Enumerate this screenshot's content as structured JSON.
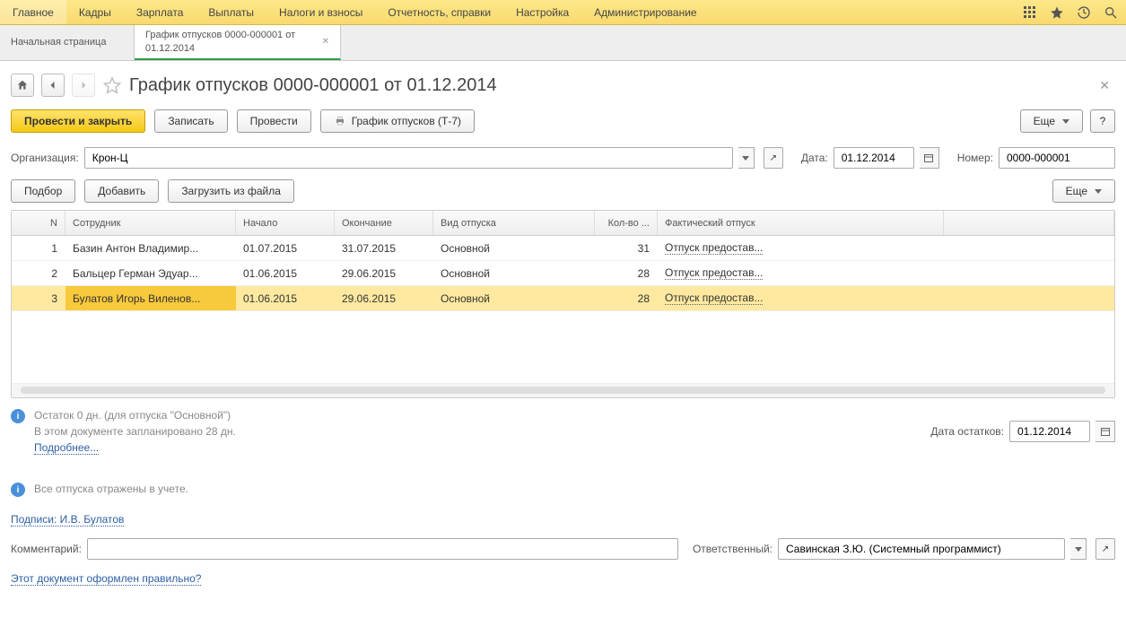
{
  "topmenu": [
    "Главное",
    "Кадры",
    "Зарплата",
    "Выплаты",
    "Налоги и взносы",
    "Отчетность, справки",
    "Настройка",
    "Администрирование"
  ],
  "tabs": {
    "home": "Начальная страница",
    "active": "График отпусков 0000-000001 от 01.12.2014"
  },
  "title": "График отпусков 0000-000001 от 01.12.2014",
  "toolbar": {
    "post_close": "Провести и закрыть",
    "save": "Записать",
    "post": "Провести",
    "print": "График отпусков (Т-7)",
    "more": "Еще"
  },
  "form": {
    "org_label": "Организация:",
    "org_value": "Крон-Ц",
    "date_label": "Дата:",
    "date_value": "01.12.2014",
    "number_label": "Номер:",
    "number_value": "0000-000001"
  },
  "toolbar2": {
    "pick": "Подбор",
    "add": "Добавить",
    "load": "Загрузить из файла",
    "more": "Еще"
  },
  "columns": {
    "n": "N",
    "emp": "Сотрудник",
    "start": "Начало",
    "end": "Окончание",
    "type": "Вид отпуска",
    "qty": "Кол-во ...",
    "fact": "Фактический отпуск"
  },
  "rows": [
    {
      "n": "1",
      "emp": "Базин Антон Владимир...",
      "start": "01.07.2015",
      "end": "31.07.2015",
      "type": "Основной",
      "qty": "31",
      "fact": "Отпуск предостав..."
    },
    {
      "n": "2",
      "emp": "Бальцер Герман Эдуар...",
      "start": "01.06.2015",
      "end": "29.06.2015",
      "type": "Основной",
      "qty": "28",
      "fact": "Отпуск предостав..."
    },
    {
      "n": "3",
      "emp": "Булатов Игорь Виленов...",
      "start": "01.06.2015",
      "end": "29.06.2015",
      "type": "Основной",
      "qty": "28",
      "fact": "Отпуск предостав..."
    }
  ],
  "selected_row": 2,
  "info": {
    "line1": "Остаток 0 дн. (для отпуска \"Основной\")",
    "line2": "В этом документе запланировано 28 дн.",
    "more": "Подробнее..."
  },
  "balance": {
    "label": "Дата остатков:",
    "value": "01.12.2014"
  },
  "info2": "Все отпуска отражены в учете.",
  "sign": {
    "prefix": "Подписи: ",
    "value": "И.В. Булатов"
  },
  "comment": {
    "label": "Комментарий:",
    "value": ""
  },
  "responsible": {
    "label": "Ответственный:",
    "value": "Савинская З.Ю. (Системный программист)"
  },
  "footlink": "Этот документ оформлен правильно?"
}
